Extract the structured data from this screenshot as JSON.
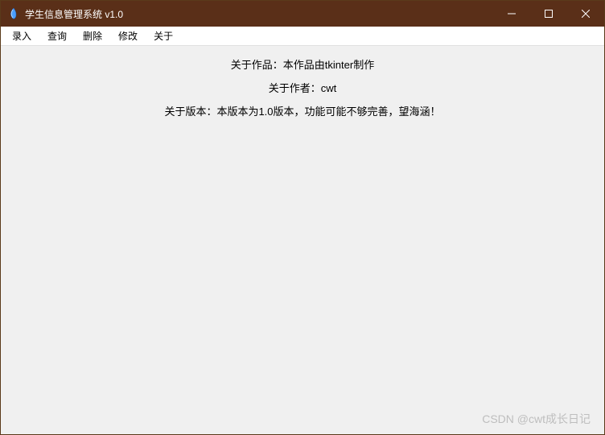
{
  "titlebar": {
    "title": "学生信息管理系统 v1.0"
  },
  "menubar": {
    "items": [
      {
        "label": "录入"
      },
      {
        "label": "查询"
      },
      {
        "label": "删除"
      },
      {
        "label": "修改"
      },
      {
        "label": "关于"
      }
    ]
  },
  "content": {
    "lines": [
      "关于作品：本作品由tkinter制作",
      "关于作者：cwt",
      "关于版本：本版本为1.0版本，功能可能不够完善，望海涵！"
    ]
  },
  "watermark": "CSDN @cwt成长日记"
}
